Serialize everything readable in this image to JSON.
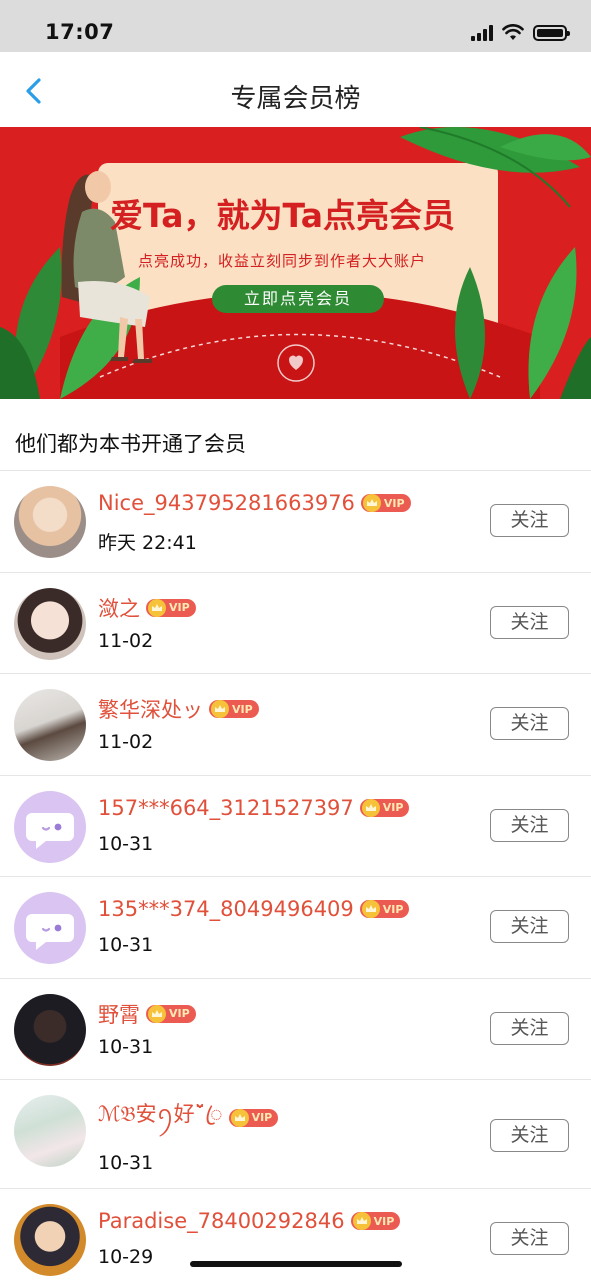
{
  "status_bar": {
    "time": "17:07"
  },
  "nav": {
    "title": "专属会员榜"
  },
  "banner": {
    "headline": "爱Ta，就为Ta点亮会员",
    "subtitle": "点亮成功，收益立刻同步到作者大大账户",
    "cta_label": "立即点亮会员"
  },
  "section": {
    "title": "他们都为本书开通了会员"
  },
  "vip_badge_label": "VIP",
  "follow_label": "关注",
  "members": [
    {
      "name": "Nice_943795281663976",
      "date": "昨天 22:41",
      "avatar": "photo"
    },
    {
      "name": "潋之",
      "date": "11-02",
      "avatar": "photo"
    },
    {
      "name": "繁华深处ッ",
      "date": "11-02",
      "avatar": "photo"
    },
    {
      "name": "157***664_3121527397",
      "date": "10-31",
      "avatar": "default-purple"
    },
    {
      "name": "135***374_8049496409",
      "date": "10-31",
      "avatar": "default-purple"
    },
    {
      "name": "野霄",
      "date": "10-31",
      "avatar": "photo"
    },
    {
      "name": "ℳ𝔅安ꪆ好ˇ̆̈ꦿ",
      "date": "10-31",
      "avatar": "photo"
    },
    {
      "name": "Paradise_78400292846",
      "date": "10-29",
      "avatar": "photo"
    }
  ],
  "colors": {
    "banner_red": "#d91f1f",
    "name_red": "#e0503a",
    "vip_red": "#ec5b52",
    "cta_green": "#2f8a34",
    "default_avatar": "#d9c4f2"
  }
}
